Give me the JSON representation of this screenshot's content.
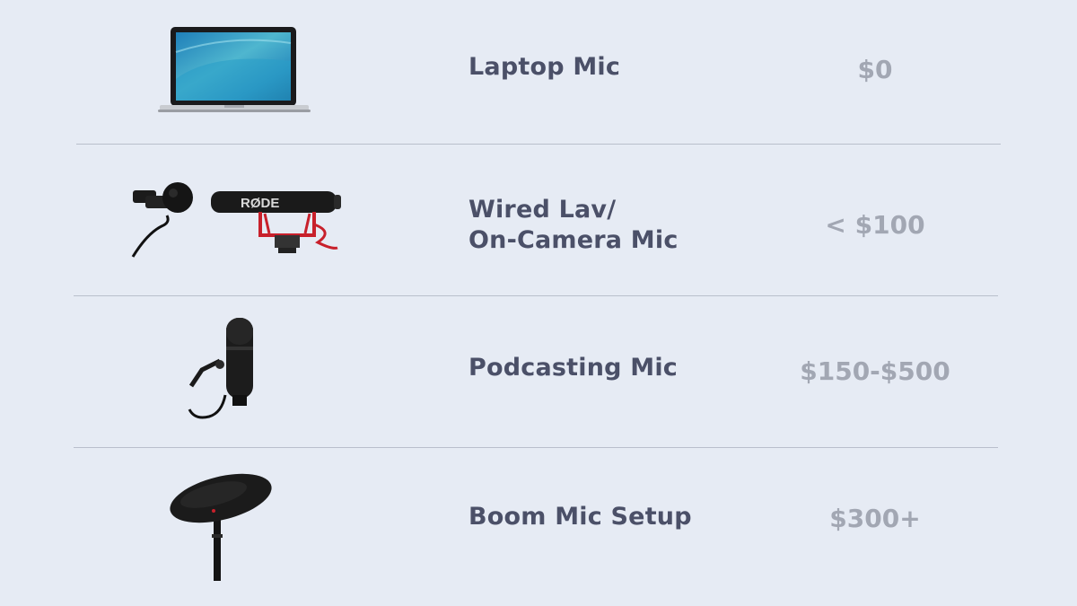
{
  "rows": [
    {
      "label": "Laptop Mic",
      "price": "$0",
      "icon": "laptop-icon"
    },
    {
      "label_line1": "Wired Lav/",
      "label_line2": "On-Camera Mic",
      "price": "< $100",
      "icon": "lav-and-shotgun-mic-icon",
      "brand_text": "RØDE"
    },
    {
      "label": "Podcasting Mic",
      "price": "$150-$500",
      "icon": "podcast-mic-icon"
    },
    {
      "label": "Boom Mic Setup",
      "price": "$300+",
      "icon": "boom-mic-icon"
    }
  ],
  "colors": {
    "background": "#e6ebf4",
    "label": "#4b5068",
    "price": "#a2a7b3",
    "divider": "#b9bfcc",
    "accent_red": "#c8202b"
  }
}
